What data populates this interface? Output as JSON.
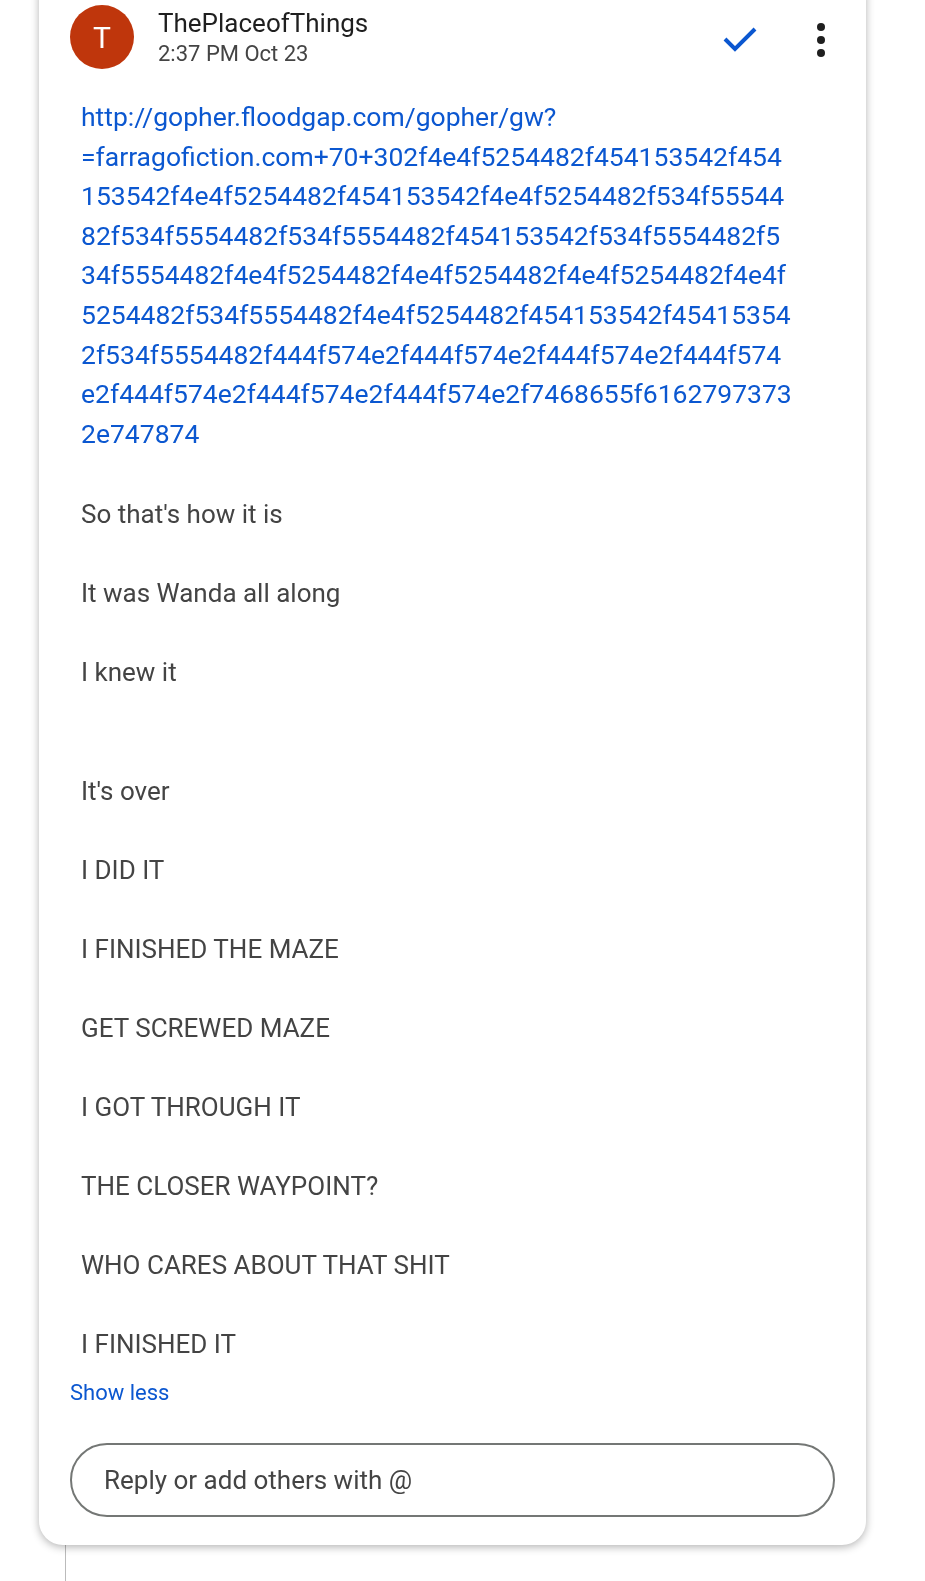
{
  "message": {
    "avatar_letter": "T",
    "sender": "ThePlaceofThings",
    "time": "2:37 PM Oct 23",
    "link": "http://gopher.floodgap.com/gopher/gw?=farragofiction.com+70+302f4e4f5254482f454153542f454153542f4e4f5254482f454153542f4e4f5254482f534f5554482f534f5554482f534f5554482f454153542f534f5554482f534f5554482f4e4f5254482f4e4f5254482f4e4f5254482f4e4f5254482f534f5554482f4e4f5254482f454153542f454153542f534f5554482f444f574e2f444f574e2f444f574e2f444f574e2f444f574e2f444f574e2f444f574e2f7468655f61627973732e747874",
    "paragraph_groups": [
      [
        "So that's how it is",
        "It was Wanda all along",
        "I knew it"
      ],
      [
        "It's over",
        "I DID IT",
        "I FINISHED THE MAZE",
        "GET SCREWED MAZE",
        "I GOT THROUGH IT",
        "THE CLOSER WAYPOINT?",
        "WHO CARES ABOUT THAT SHIT",
        "I FINISHED IT"
      ]
    ],
    "toggle": "Show less"
  },
  "reply": {
    "placeholder": "Reply or add others with @"
  }
}
